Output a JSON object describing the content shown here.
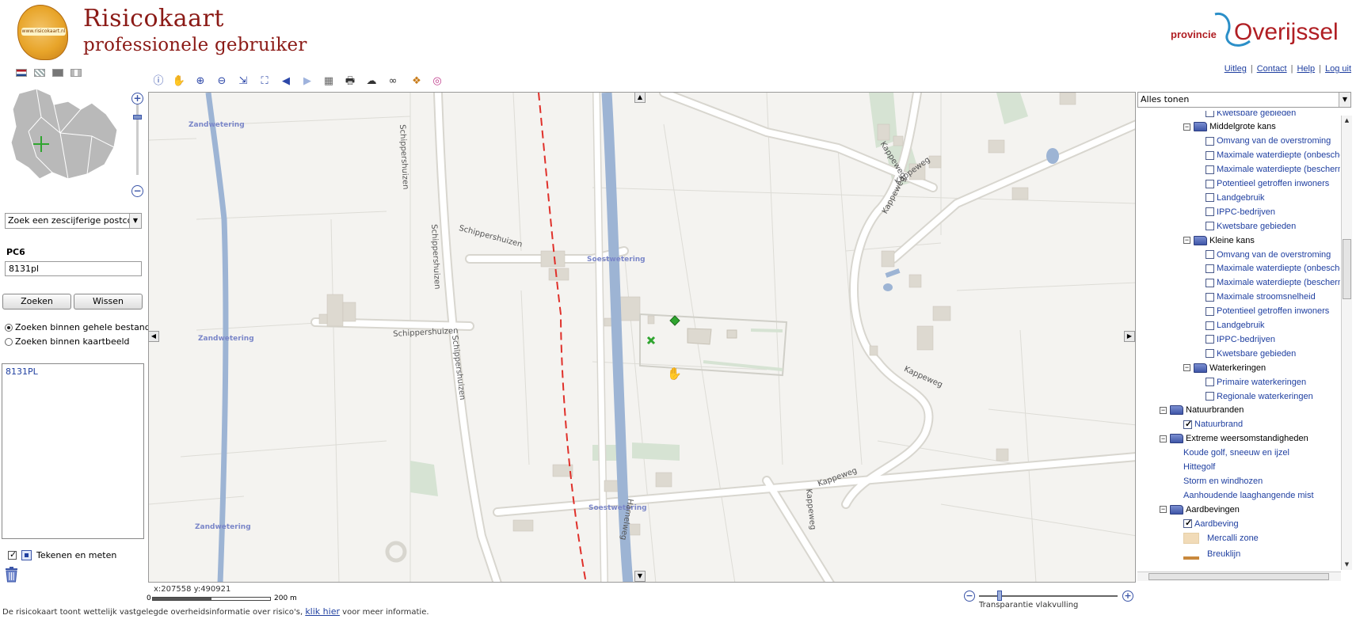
{
  "header": {
    "logo_text": "www.risicokaart.nl",
    "title_line1": "Risicokaart",
    "title_line2": "professionele gebruiker",
    "province_word": "provincie",
    "province_name": "Overijssel"
  },
  "top_links": [
    "Uitleg",
    "Contact",
    "Help",
    "Log uit"
  ],
  "languages": [
    "nl-flag-icon",
    "en-flag-icon",
    "print-layout-icon",
    "layout-columns-icon"
  ],
  "toolbar": [
    {
      "name": "info-tool",
      "icon": "ⓘ"
    },
    {
      "name": "pan-tool",
      "icon": "✋"
    },
    {
      "name": "zoom-in-tool",
      "icon": "⊕"
    },
    {
      "name": "zoom-out-tool",
      "icon": "⊖"
    },
    {
      "name": "zoom-extent-tool",
      "icon": "⇲"
    },
    {
      "name": "zoom-fullscreen-tool",
      "icon": "⛶"
    },
    {
      "name": "previous-extent-tool",
      "icon": "◀"
    },
    {
      "name": "next-extent-tool",
      "icon": "▶"
    },
    {
      "name": "grid-tool",
      "icon": "▦"
    },
    {
      "name": "print-tool",
      "icon": "🖶"
    },
    {
      "name": "cloud-tool",
      "icon": "☁"
    },
    {
      "name": "link-tool",
      "icon": "∞"
    },
    {
      "name": "layers-tool",
      "icon": "❖"
    },
    {
      "name": "overlay-tool",
      "icon": "◎"
    }
  ],
  "search": {
    "type_select": "Zoek een zescijferige postcode",
    "pc6_label": "PC6",
    "pc6_value": "8131pl",
    "search_button": "Zoeken",
    "clear_button": "Wissen",
    "radio_whole": "Zoeken binnen gehele bestand",
    "radio_view": "Zoeken binnen kaartbeeld",
    "results": [
      "8131PL"
    ]
  },
  "draw": {
    "label": "Tekenen en meten"
  },
  "map": {
    "coords": "x:207558 y:490921",
    "scale_start": "0",
    "scale_end": "200 m",
    "water_labels": [
      "Zandwetering",
      "Zandwetering",
      "Zandwetering",
      "Soestwetering",
      "Soestwetering"
    ],
    "street_labels": [
      "Schippershuizen",
      "Schippershuizen",
      "Schippershuizen",
      "Schippershuizen",
      "Schippershuizen",
      "Kappeweg",
      "Kappeweg",
      "Kappeweg",
      "Kappeweg",
      "Kappeweg",
      "Kappeweg",
      "Hamelweg"
    ]
  },
  "footer": {
    "text_before": "De risicokaart toont wettelijk vastgelegde overheidsinformatie over risico's,",
    "link": "klik hier",
    "text_after": "voor meer informatie."
  },
  "transparency": {
    "label": "Transparantie vlakvulling"
  },
  "layers": {
    "select": "Alles tonen",
    "tree": [
      {
        "level": 3,
        "kind": "layer",
        "label": "Kwetsbare gebieden",
        "checked": false
      },
      {
        "level": 2,
        "kind": "group",
        "label": "Middelgrote kans"
      },
      {
        "level": 3,
        "kind": "layer",
        "label": "Omvang van de overstroming",
        "checked": false
      },
      {
        "level": 3,
        "kind": "layer",
        "label": "Maximale waterdiepte (onbeschermd)",
        "checked": false
      },
      {
        "level": 3,
        "kind": "layer",
        "label": "Maximale waterdiepte (beschermd)",
        "checked": false
      },
      {
        "level": 3,
        "kind": "layer",
        "label": "Potentieel getroffen inwoners",
        "checked": false
      },
      {
        "level": 3,
        "kind": "layer",
        "label": "Landgebruik",
        "checked": false
      },
      {
        "level": 3,
        "kind": "layer",
        "label": "IPPC-bedrijven",
        "checked": false
      },
      {
        "level": 3,
        "kind": "layer",
        "label": "Kwetsbare gebieden",
        "checked": false
      },
      {
        "level": 2,
        "kind": "group",
        "label": "Kleine kans"
      },
      {
        "level": 3,
        "kind": "layer",
        "label": "Omvang van de overstroming",
        "checked": false
      },
      {
        "level": 3,
        "kind": "layer",
        "label": "Maximale waterdiepte (onbeschermd)",
        "checked": false
      },
      {
        "level": 3,
        "kind": "layer",
        "label": "Maximale waterdiepte (beschermd)",
        "checked": false
      },
      {
        "level": 3,
        "kind": "layer",
        "label": "Maximale stroomsnelheid",
        "checked": false
      },
      {
        "level": 3,
        "kind": "layer",
        "label": "Potentieel getroffen inwoners",
        "checked": false
      },
      {
        "level": 3,
        "kind": "layer",
        "label": "Landgebruik",
        "checked": false
      },
      {
        "level": 3,
        "kind": "layer",
        "label": "IPPC-bedrijven",
        "checked": false
      },
      {
        "level": 3,
        "kind": "layer",
        "label": "Kwetsbare gebieden",
        "checked": false
      },
      {
        "level": 2,
        "kind": "group",
        "label": "Waterkeringen"
      },
      {
        "level": 3,
        "kind": "layer",
        "label": "Primaire waterkeringen",
        "checked": false
      },
      {
        "level": 3,
        "kind": "layer",
        "label": "Regionale waterkeringen",
        "checked": false
      },
      {
        "level": 1,
        "kind": "group",
        "label": "Natuurbranden"
      },
      {
        "level": 2,
        "kind": "layer",
        "label": "Natuurbrand",
        "checked": true
      },
      {
        "level": 1,
        "kind": "group",
        "label": "Extreme weersomstandigheden"
      },
      {
        "level": 2,
        "kind": "link",
        "label": "Koude golf, sneeuw en ijzel"
      },
      {
        "level": 2,
        "kind": "link",
        "label": "Hittegolf"
      },
      {
        "level": 2,
        "kind": "link",
        "label": "Storm en windhozen"
      },
      {
        "level": 2,
        "kind": "link",
        "label": "Aanhoudende laaghangende mist"
      },
      {
        "level": 1,
        "kind": "group",
        "label": "Aardbevingen"
      },
      {
        "level": 2,
        "kind": "layer",
        "label": "Aardbeving",
        "checked": true
      },
      {
        "level": 2,
        "kind": "legend",
        "label": "Mercalli zone"
      },
      {
        "level": 2,
        "kind": "legend-partial",
        "label": "Breuklijn"
      }
    ]
  },
  "colors": {
    "brand_red": "#8b1a16",
    "province_red": "#b01e23",
    "link_blue": "#1f3fa0",
    "water_blue": "#9db4d4",
    "hazard_red": "#e0302a",
    "marker_green": "#2fa52f"
  }
}
